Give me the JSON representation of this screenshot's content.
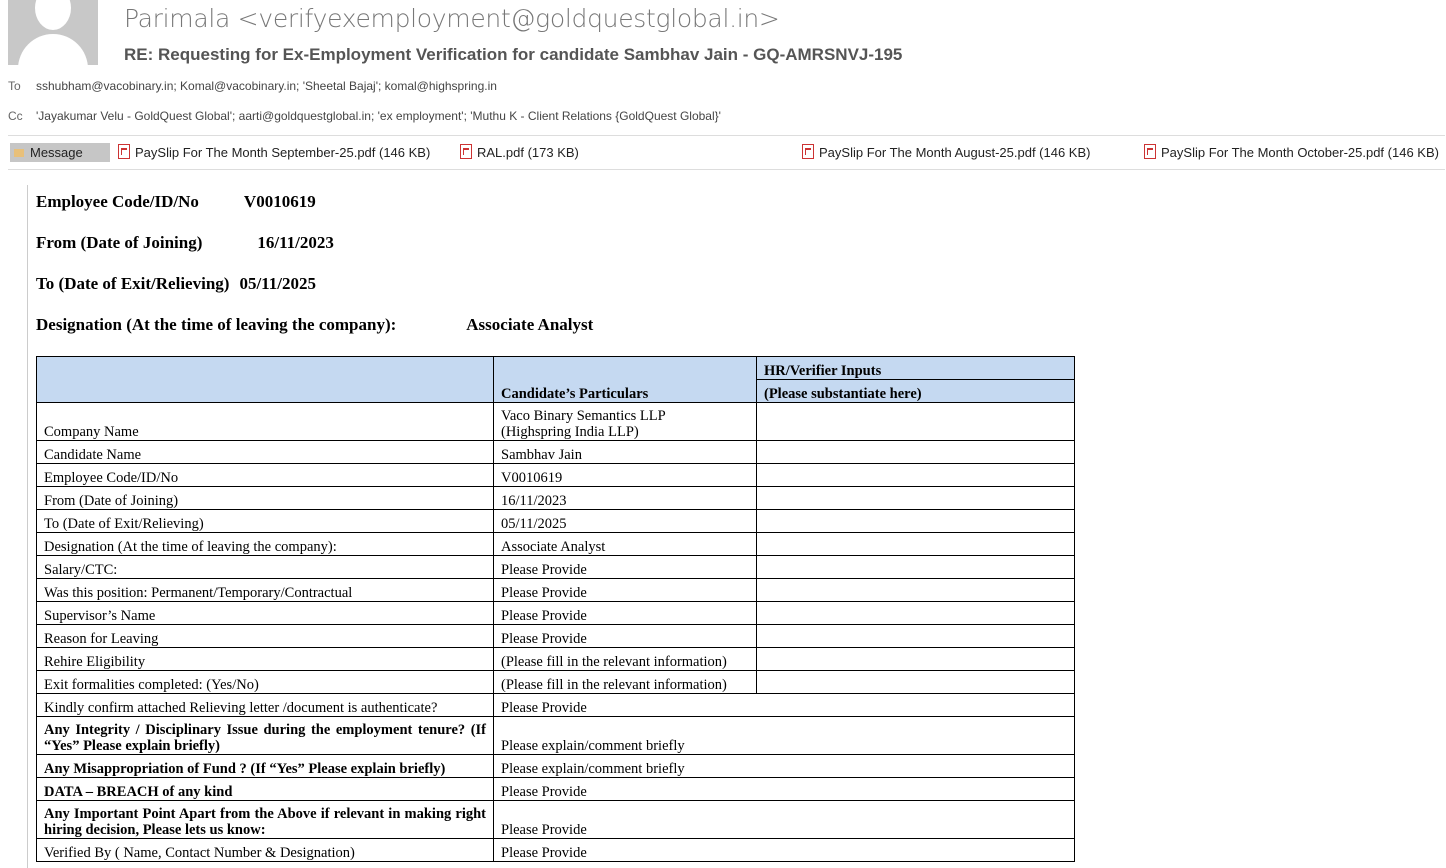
{
  "email": {
    "from": "Parimala <verifyexemployment@goldquestglobal.in>",
    "subject": "RE: Requesting for Ex-Employment Verification for candidate Sambhav Jain - GQ-AMRSNVJ-195",
    "to_label": "To",
    "to": "sshubham@vacobinary.in; Komal@vacobinary.in; 'Sheetal Bajaj'; komal@highspring.in",
    "cc_label": "Cc",
    "cc": "'Jayakumar Velu - GoldQuest Global'; aarti@goldquestglobal.in; 'ex employment'; 'Muthu K - Client Relations {GoldQuest Global}'",
    "message_tab": "Message",
    "attachments": [
      "PaySlip For The Month September-25.pdf (146 KB)",
      "RAL.pdf (173 KB)",
      "PaySlip For The Month August-25.pdf (146 KB)",
      "PaySlip For The Month October-25.pdf (146 KB)"
    ]
  },
  "doc": {
    "emp_label": "Employee Code/ID/No",
    "emp_value": "V0010619",
    "from_label": "From (Date of Joining)",
    "from_value": "16/11/2023",
    "to_label": "To (Date of Exit/Relieving)",
    "to_value": "05/11/2025",
    "desig_label": "Designation (At the time of leaving the company):",
    "desig_value": "Associate Analyst"
  },
  "table": {
    "h_col2": "Candidate’s Particulars",
    "h_col3a": "HR/Verifier Inputs",
    "h_col3b": "(Please substantiate here)",
    "rows": [
      {
        "label": "Company Name",
        "value": "Vaco Binary Semantics LLP",
        "value2": "(Highspring India LLP)"
      },
      {
        "label": "Candidate Name",
        "value": "Sambhav Jain"
      },
      {
        "label": "Employee Code/ID/No",
        "value": "V0010619"
      },
      {
        "label": "From (Date of Joining)",
        "value": "16/11/2023"
      },
      {
        "label": "To (Date of Exit/Relieving)",
        "value": "05/11/2025"
      },
      {
        "label": "Designation (At the time of leaving the company):",
        "value": "Associate Analyst"
      },
      {
        "label": "Salary/CTC:",
        "value": "Please Provide"
      },
      {
        "label": "Was this position: Permanent/Temporary/Contractual",
        "value": "Please Provide"
      },
      {
        "label": "Supervisor’s Name",
        "value": "Please Provide"
      },
      {
        "label": "Reason for Leaving",
        "value": "Please Provide"
      },
      {
        "label": "Rehire Eligibility",
        "value": "(Please fill in the relevant information)"
      },
      {
        "label": "Exit formalities completed: (Yes/No)",
        "value": "(Please fill in the relevant information)"
      },
      {
        "label": "Kindly confirm attached Relieving letter /document is authenticate?",
        "value": "Please Provide"
      },
      {
        "label": "Any Integrity / Disciplinary Issue during the employment tenure? (If “Yes” Please explain briefly)",
        "value": "Please explain/comment briefly"
      },
      {
        "label": "Any Misappropriation of Fund ? (If “Yes” Please explain briefly)",
        "value": "Please explain/comment briefly"
      },
      {
        "label": "DATA – BREACH of any kind",
        "value": "Please Provide"
      },
      {
        "label": "Any Important Point Apart from the Above if relevant in making right hiring decision, Please lets us know:",
        "value": "Please Provide"
      },
      {
        "label": "Verified By ( Name, Contact Number & Designation)",
        "value": "Please Provide"
      }
    ]
  }
}
